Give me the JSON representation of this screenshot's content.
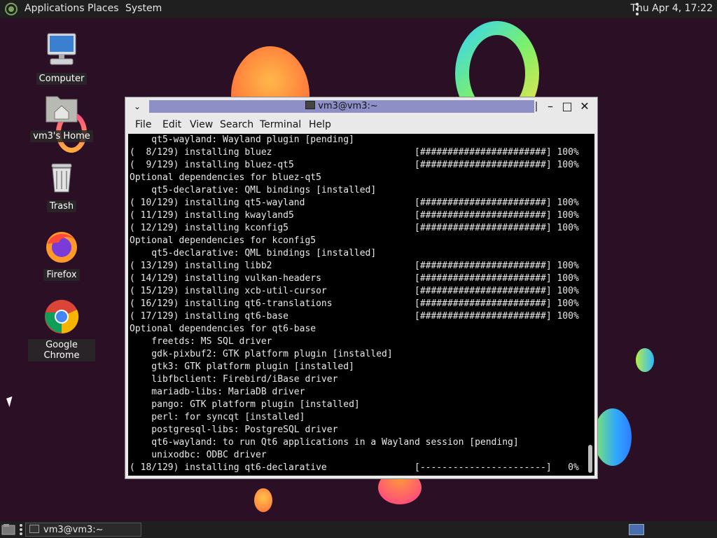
{
  "top_panel": {
    "menus": [
      "Applications",
      "Places",
      "System"
    ],
    "clock": "Thu Apr  4, 17:22"
  },
  "desktop_icons": [
    {
      "label": "Computer",
      "icon": "computer-icon"
    },
    {
      "label": "vm3's Home",
      "icon": "home-folder-icon"
    },
    {
      "label": "Trash",
      "icon": "trash-icon"
    },
    {
      "label": "Firefox",
      "icon": "firefox-icon"
    },
    {
      "label": "Google Chrome",
      "icon": "chrome-icon"
    }
  ],
  "terminal": {
    "title": "vm3@vm3:~",
    "menu": [
      "File",
      "Edit",
      "View",
      "Search",
      "Terminal",
      "Help"
    ],
    "lines": [
      "    qt5-wayland: Wayland plugin [pending]",
      "(  8/129) installing bluez                          [#######################] 100%",
      "(  9/129) installing bluez-qt5                      [#######################] 100%",
      "Optional dependencies for bluez-qt5",
      "    qt5-declarative: QML bindings [installed]",
      "( 10/129) installing qt5-wayland                    [#######################] 100%",
      "( 11/129) installing kwayland5                      [#######################] 100%",
      "( 12/129) installing kconfig5                       [#######################] 100%",
      "Optional dependencies for kconfig5",
      "    qt5-declarative: QML bindings [installed]",
      "( 13/129) installing libb2                          [#######################] 100%",
      "( 14/129) installing vulkan-headers                 [#######################] 100%",
      "( 15/129) installing xcb-util-cursor                [#######################] 100%",
      "( 16/129) installing qt6-translations               [#######################] 100%",
      "( 17/129) installing qt6-base                       [#######################] 100%",
      "Optional dependencies for qt6-base",
      "    freetds: MS SQL driver",
      "    gdk-pixbuf2: GTK platform plugin [installed]",
      "    gtk3: GTK platform plugin [installed]",
      "    libfbclient: Firebird/iBase driver",
      "    mariadb-libs: MariaDB driver",
      "    pango: GTK platform plugin [installed]",
      "    perl: for syncqt [installed]",
      "    postgresql-libs: PostgreSQL driver",
      "    qt6-wayland: to run Qt6 applications in a Wayland session [pending]",
      "    unixodbc: ODBC driver",
      "( 18/129) installing qt6-declarative                [-----------------------]   0%"
    ]
  },
  "taskbar": {
    "task_label": "vm3@vm3:~"
  }
}
